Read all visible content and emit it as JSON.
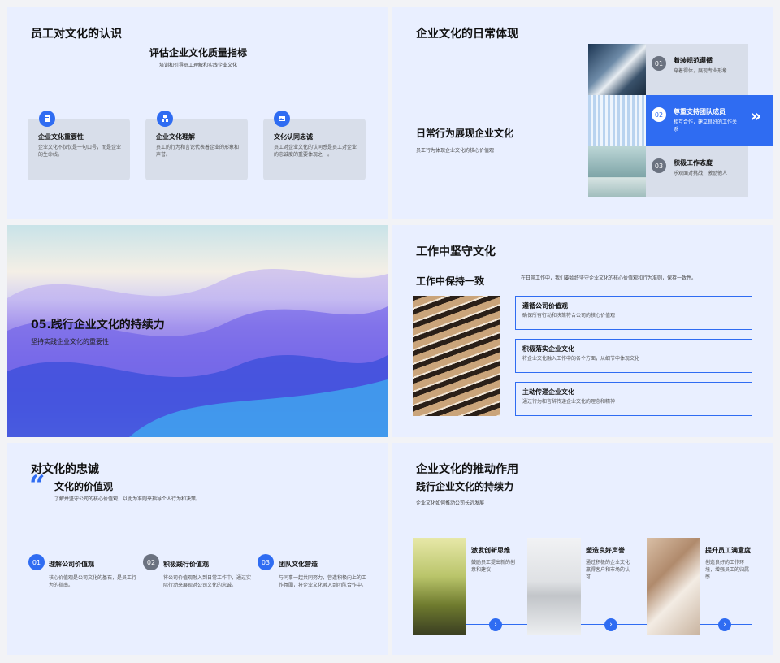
{
  "slide1": {
    "title": "员工对文化的认识",
    "heading": "评估企业文化质量指标",
    "subheading": "培训和引导员工理解和实践企业文化",
    "cards": [
      {
        "title": "企业文化重要性",
        "text": "企业文化不仅仅是一句口号，而是企业的生命线。",
        "icon": "document-icon"
      },
      {
        "title": "企业文化理解",
        "text": "员工的行为和言论代表着企业的形象和声誉。",
        "icon": "network-icon"
      },
      {
        "title": "文化认同忠诚",
        "text": "员工对企业文化的认同感是员工对企业的忠诚度的重要体现之一。",
        "icon": "image-icon"
      }
    ]
  },
  "slide2": {
    "title": "企业文化的日常体现",
    "heading": "日常行为展现企业文化",
    "subheading": "员工行为体现企业文化的核心价值观",
    "items": [
      {
        "num": "01",
        "title": "着装规范遵循",
        "text": "穿着得体，展现专业形象"
      },
      {
        "num": "02",
        "title": "尊重支持团队成员",
        "text": "相互合作，建立良好的工作关系"
      },
      {
        "num": "03",
        "title": "积极工作态度",
        "text": "乐观面对挑战，激励他人"
      }
    ],
    "arrow": "»"
  },
  "slide3": {
    "title": "05.践行企业文化的持续力",
    "subtitle": "坚持实践企业文化的重要性"
  },
  "slide4": {
    "title": "工作中坚守文化",
    "heading": "工作中保持一致",
    "intro": "在日常工作中，我们要始终坚守企业文化的核心价值观和行为准则，保持一致性。",
    "boxes": [
      {
        "title": "遵循公司价值观",
        "text": "确保所有行动和决策符合公司的核心价值观"
      },
      {
        "title": "积极落实企业文化",
        "text": "将企业文化融入工作中的各个方面，从细节中体现文化"
      },
      {
        "title": "主动传递企业文化",
        "text": "通过行为和言辞传递企业文化的理念和精神"
      }
    ]
  },
  "slide5": {
    "title": "对文化的忠诚",
    "quote_mark": "“",
    "heading": "文化的价值观",
    "subheading": "了解并坚守公司的核心价值观，以此为准则来指导个人行为和决策。",
    "items": [
      {
        "num": "01",
        "title": "理解公司价值观",
        "text": "核心价值观是公司文化的基石，是员工行为的指南。",
        "color": "#2f6cf2"
      },
      {
        "num": "02",
        "title": "积极践行价值观",
        "text": "将公司价值观融入到日常工作中，通过实际行动来展现对公司文化的忠诚。",
        "color": "#6b7280"
      },
      {
        "num": "03",
        "title": "团队文化营造",
        "text": "与同事一起共同努力，营造积极向上的工作氛围，将企业文化融入到团队合作中。",
        "color": "#2f6cf2"
      }
    ]
  },
  "slide6": {
    "title": "企业文化的推动作用",
    "heading": "践行企业文化的持续力",
    "subheading": "企业文化如何推动公司长远发展",
    "items": [
      {
        "title": "激发创新思维",
        "text": "鼓励员工提出新的创意和建议"
      },
      {
        "title": "塑造良好声誉",
        "text": "通过积极的企业文化赢得客户和市场的认可"
      },
      {
        "title": "提升员工满意度",
        "text": "创造良好的工作环境，增强员工的归属感"
      }
    ],
    "arrow": "›"
  }
}
